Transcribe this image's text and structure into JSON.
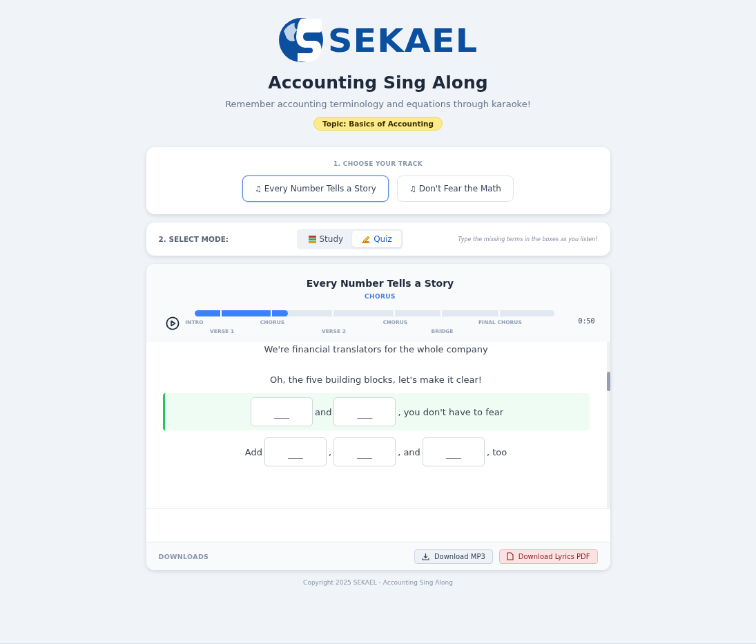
{
  "header": {
    "logo_text": "SEKAEL",
    "title": "Accounting Sing Along",
    "subtitle": "Remember accounting terminology and equations through karaoke!",
    "topic_badge": "Topic: Basics of Accounting"
  },
  "track_picker": {
    "heading": "1. CHOOSE YOUR TRACK",
    "tracks": [
      {
        "icon": "♫",
        "label": "Every Number Tells a Story",
        "selected": true
      },
      {
        "icon": "♫",
        "label": "Don't Fear the Math",
        "selected": false
      }
    ]
  },
  "mode_picker": {
    "heading": "2. SELECT MODE:",
    "modes": [
      {
        "kind": "study",
        "label": "Study",
        "selected": false
      },
      {
        "kind": "quiz",
        "label": "Quiz",
        "selected": true
      }
    ],
    "hint": "Type the missing terms in the boxes as you listen!"
  },
  "player": {
    "song_title": "Every Number Tells a Story",
    "current_section": "CHORUS",
    "level": 0.26,
    "time": "0:50",
    "sections": [
      {
        "label": "INTRO"
      },
      {
        "label": "VERSE 1"
      },
      {
        "label": "CHORUS"
      },
      {
        "label": "VERSE 2"
      },
      {
        "label": "CHORUS"
      },
      {
        "label": "BRIDGE"
      },
      {
        "label": "FINAL CHORUS"
      }
    ]
  },
  "lyrics": [
    {
      "active": false,
      "parts": [
        {
          "kind": "text",
          "text": "We're financial translators for the whole company"
        }
      ]
    },
    {
      "active": false,
      "parts": [
        {
          "kind": "text",
          "text": "Oh, the five building blocks, let's make it clear!"
        }
      ]
    },
    {
      "active": true,
      "parts": [
        {
          "kind": "blank",
          "placeholder": "___"
        },
        {
          "kind": "text",
          "text": "and"
        },
        {
          "kind": "blank",
          "placeholder": "___"
        },
        {
          "kind": "text",
          "text": ", you don't have to fear"
        }
      ]
    },
    {
      "active": false,
      "parts": [
        {
          "kind": "text",
          "text": "Add"
        },
        {
          "kind": "blank",
          "placeholder": "___"
        },
        {
          "kind": "text",
          "text": ","
        },
        {
          "kind": "blank",
          "placeholder": "___"
        },
        {
          "kind": "text",
          "text": ", and"
        },
        {
          "kind": "blank",
          "placeholder": "___"
        },
        {
          "kind": "text",
          "text": ", too"
        }
      ]
    }
  ],
  "downloads": {
    "heading": "DOWNLOADS",
    "buttons": [
      {
        "kind": "mp3",
        "label": "Download MP3"
      },
      {
        "kind": "pdf",
        "label": "Download Lyrics PDF"
      }
    ]
  },
  "footer": "Copyright 2025 SEKAEL - Accounting Sing Along"
}
